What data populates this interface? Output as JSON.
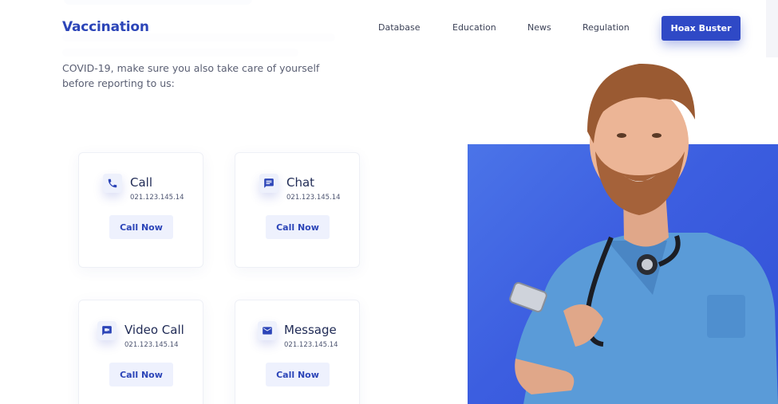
{
  "nav": {
    "logo": "Vaccination",
    "links": [
      "Database",
      "Education",
      "News",
      "Regulation"
    ],
    "cta": "Hoax Buster"
  },
  "intro": {
    "text": "COVID-19, make sure you also take care of yourself before reporting to us:"
  },
  "cards": [
    {
      "icon": "phone-icon",
      "title": "Call",
      "phone": "021.123.145.14",
      "button": "Call Now"
    },
    {
      "icon": "chat-icon",
      "title": "Chat",
      "phone": "021.123.145.14",
      "button": "Call Now"
    },
    {
      "icon": "video-call-icon",
      "title": "Video Call",
      "phone": "021.123.145.14",
      "button": "Call Now"
    },
    {
      "icon": "mail-icon",
      "title": "Message",
      "phone": "021.123.145.14",
      "button": "Call Now"
    }
  ],
  "colors": {
    "brand": "#2c45b8",
    "cta": "#2f49c6",
    "hero": "#3c5ee0"
  }
}
